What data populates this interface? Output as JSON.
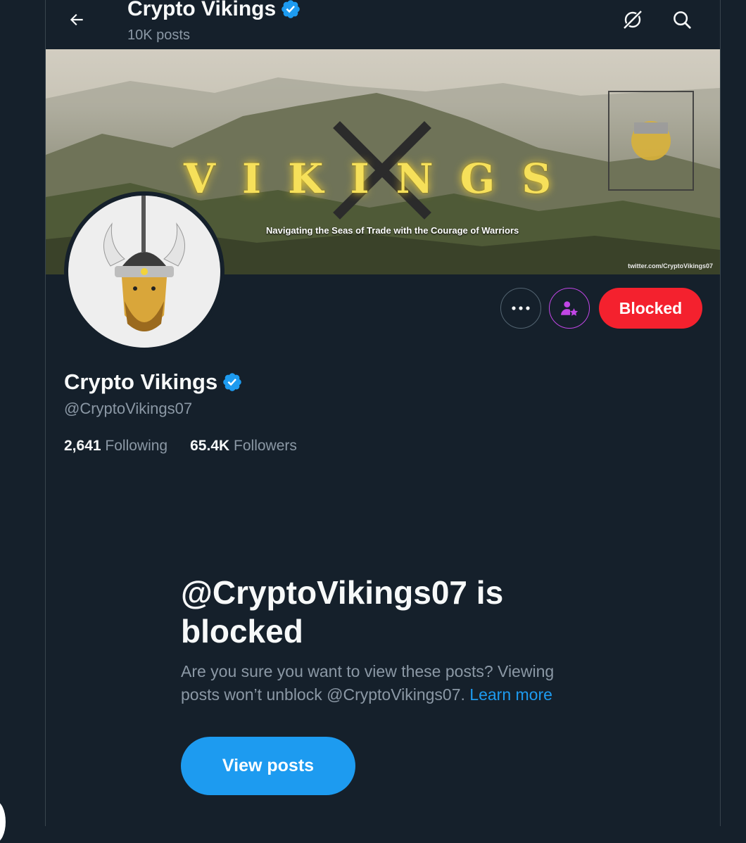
{
  "header": {
    "name": "Crypto Vikings",
    "posts": "10K posts",
    "icons": [
      "back-arrow-icon",
      "grok-icon",
      "search-icon"
    ]
  },
  "banner": {
    "title": "VIKINGS",
    "subtitle": "Navigating the Seas of Trade with the Courage of Warriors",
    "handle": "twitter.com/CryptoVikings07"
  },
  "actions": {
    "blocked_label": "Blocked"
  },
  "profile": {
    "name": "Crypto Vikings",
    "handle": "@CryptoVikings07",
    "following_count": "2,641",
    "following_label": "Following",
    "followers_count": "65.4K",
    "followers_label": "Followers"
  },
  "blocked_notice": {
    "title": "@CryptoVikings07 is blocked",
    "description": "Are you sure you want to view these posts? Viewing posts won’t unblock @CryptoVikings07.",
    "learn_more": "Learn more",
    "view_posts": "View posts"
  },
  "colors": {
    "background": "#15202b",
    "accent": "#1d9bf0",
    "blocked": "#f4212e",
    "subscribe": "#c146e6"
  }
}
